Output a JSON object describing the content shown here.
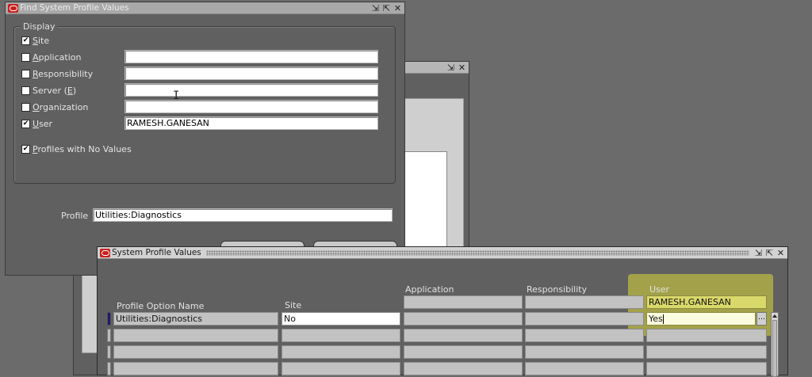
{
  "find_window": {
    "title": "Find System Profile Values",
    "display_group_label": "Display",
    "levels": [
      {
        "key": "S",
        "rest": "ite",
        "checked": true,
        "value": ""
      },
      {
        "key": "A",
        "rest": "pplication",
        "checked": false,
        "value": ""
      },
      {
        "key": "R",
        "rest": "esponsibility",
        "checked": false,
        "value": ""
      },
      {
        "key": "",
        "rest": "Server (",
        "key2": "E",
        "rest2": ")",
        "checked": false,
        "value": ""
      },
      {
        "key": "O",
        "rest": "rganization",
        "checked": false,
        "value": ""
      },
      {
        "key": "U",
        "rest": "ser",
        "checked": true,
        "value": "RAMESH.GANESAN"
      }
    ],
    "profiles_no_values": {
      "key": "P",
      "rest": "rofiles with No Values",
      "checked": true
    },
    "profile_label": "Profile",
    "profile_value": "Utilities:Diagnostics"
  },
  "values_window": {
    "title": "System Profile Values",
    "headers": {
      "profile_option_name": "Profile Option Name",
      "site": "Site",
      "application": "Application",
      "responsibility": "Responsibility",
      "user": "User"
    },
    "user_context": "RAMESH.GANESAN",
    "rows": [
      {
        "name": "Utilities:Diagnostics",
        "site": "No",
        "application": "",
        "responsibility": "",
        "user": "Yes"
      }
    ],
    "check_mark": "✔",
    "lov_button": "…"
  },
  "colors": {
    "background": "#6b6b6b",
    "window": "#606060",
    "highlight": "#d9d86a",
    "oracle_red": "#c8201d"
  },
  "icons": [
    "oracle-logo-icon",
    "minimize-icon",
    "restore-icon",
    "close-icon"
  ]
}
